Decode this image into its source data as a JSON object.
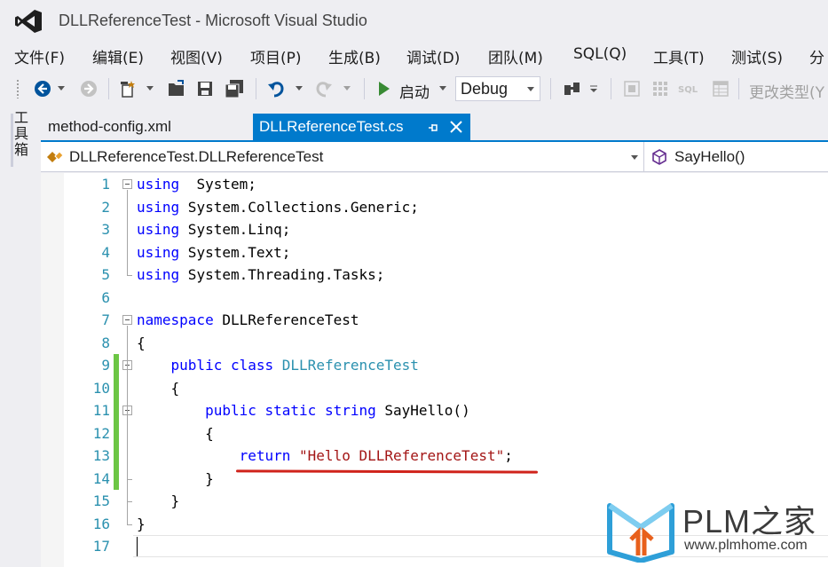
{
  "window": {
    "title": "DLLReferenceTest - Microsoft Visual Studio"
  },
  "menu": [
    "文件(F)",
    "编辑(E)",
    "视图(V)",
    "项目(P)",
    "生成(B)",
    "调试(D)",
    "团队(M)",
    "SQL(Q)",
    "工具(T)",
    "测试(S)",
    "分"
  ],
  "toolbar": {
    "start_label": "启动",
    "config_value": "Debug",
    "change_type_label": "更改类型(Y"
  },
  "sidebar": {
    "toolbox_label": "工具箱"
  },
  "tabs": [
    {
      "label": "method-config.xml",
      "active": false
    },
    {
      "label": "DLLReferenceTest.cs",
      "active": true
    }
  ],
  "navbar": {
    "type_scope": "DLLReferenceTest.DLLReferenceTest",
    "member_scope": "SayHello()"
  },
  "editor": {
    "lines": [
      {
        "n": "1",
        "tokens": [
          [
            "kw",
            "using"
          ],
          [
            "",
            "  System;"
          ]
        ]
      },
      {
        "n": "2",
        "tokens": [
          [
            "kw",
            "using"
          ],
          [
            "",
            " System.Collections.Generic;"
          ]
        ]
      },
      {
        "n": "3",
        "tokens": [
          [
            "kw",
            "using"
          ],
          [
            "",
            " System.Linq;"
          ]
        ]
      },
      {
        "n": "4",
        "tokens": [
          [
            "kw",
            "using"
          ],
          [
            "",
            " System.Text;"
          ]
        ]
      },
      {
        "n": "5",
        "tokens": [
          [
            "kw",
            "using"
          ],
          [
            "",
            " System.Threading.Tasks;"
          ]
        ]
      },
      {
        "n": "6",
        "tokens": []
      },
      {
        "n": "7",
        "tokens": [
          [
            "kw",
            "namespace"
          ],
          [
            "",
            " DLLReferenceTest"
          ]
        ]
      },
      {
        "n": "8",
        "tokens": [
          [
            "",
            "{"
          ]
        ]
      },
      {
        "n": "9",
        "tokens": [
          [
            "",
            "    "
          ],
          [
            "kw",
            "public"
          ],
          [
            "",
            " "
          ],
          [
            "kw",
            "class"
          ],
          [
            "",
            " "
          ],
          [
            "ty",
            "DLLReferenceTest"
          ]
        ]
      },
      {
        "n": "10",
        "tokens": [
          [
            "",
            "    {"
          ]
        ]
      },
      {
        "n": "11",
        "tokens": [
          [
            "",
            "        "
          ],
          [
            "kw",
            "public"
          ],
          [
            "",
            " "
          ],
          [
            "kw",
            "static"
          ],
          [
            "",
            " "
          ],
          [
            "kw",
            "string"
          ],
          [
            "",
            " SayHello()"
          ]
        ]
      },
      {
        "n": "12",
        "tokens": [
          [
            "",
            "        {"
          ]
        ]
      },
      {
        "n": "13",
        "tokens": [
          [
            "",
            "            "
          ],
          [
            "kw",
            "return"
          ],
          [
            "",
            " "
          ],
          [
            "str",
            "\"Hello DLLReferenceTest\""
          ],
          [
            "",
            ";"
          ]
        ]
      },
      {
        "n": "14",
        "tokens": [
          [
            "",
            "        }"
          ]
        ]
      },
      {
        "n": "15",
        "tokens": [
          [
            "",
            "    }"
          ]
        ]
      },
      {
        "n": "16",
        "tokens": [
          [
            "",
            "}"
          ]
        ]
      },
      {
        "n": "17",
        "tokens": []
      }
    ],
    "changed_lines": [
      9,
      10,
      11,
      12,
      13,
      14
    ],
    "fold_lines": [
      1,
      7,
      9,
      11
    ]
  },
  "watermark": {
    "title": "PLM之家",
    "url": "www.plmhome.com"
  },
  "colors": {
    "accent": "#007acc",
    "keyword": "#0000ff",
    "type": "#2b91af",
    "string": "#a31515",
    "changed": "#6cc644"
  }
}
